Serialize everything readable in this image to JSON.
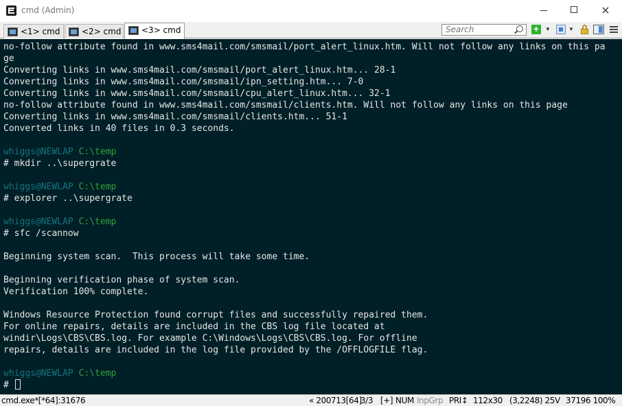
{
  "window": {
    "title": "cmd (Admin)",
    "app_icon": "conemu-icon",
    "controls": {
      "minimize": "minimize-icon",
      "maximize": "maximize-icon",
      "close": "×"
    }
  },
  "tabs": [
    {
      "label": "<1> cmd",
      "icon": "console-icon",
      "active": false
    },
    {
      "label": "<2> cmd",
      "icon": "console-icon",
      "active": false
    },
    {
      "label": "<3> cmd",
      "icon": "console-icon",
      "active": true
    }
  ],
  "toolbar": {
    "search_placeholder": "Search",
    "new_console": "+",
    "dropdown": "▼"
  },
  "console": {
    "lines": [
      "no-follow attribute found in www.sms4mail.com/smsmail/port_alert_linux.htm. Will not follow any links on this pa",
      "ge",
      "Converting links in www.sms4mail.com/smsmail/port_alert_linux.htm... 28-1",
      "Converting links in www.sms4mail.com/smsmail/ipn_setting.htm... 7-0",
      "Converting links in www.sms4mail.com/smsmail/cpu_alert_linux.htm... 32-1",
      "no-follow attribute found in www.sms4mail.com/smsmail/clients.htm. Will not follow any links on this page",
      "Converting links in www.sms4mail.com/smsmail/clients.htm... 51-1",
      "Converted links in 40 files in 0.3 seconds.",
      "",
      "",
      "# mkdir ..\\supergrate",
      "",
      "",
      "# explorer ..\\supergrate",
      "",
      "",
      "# sfc /scannow",
      "",
      "Beginning system scan.  This process will take some time.",
      "",
      "Beginning verification phase of system scan.",
      "Verification 100% complete.",
      "",
      "Windows Resource Protection found corrupt files and successfully repaired them.",
      "For online repairs, details are included in the CBS log file located at",
      "windir\\Logs\\CBS\\CBS.log. For example C:\\Windows\\Logs\\CBS\\CBS.log. For offline",
      "repairs, details are included in the log file provided by the /OFFLOGFILE flag.",
      "",
      "",
      "# "
    ],
    "prompt_user": "whiggs@NEWLAP",
    "prompt_path": "C:\\temp",
    "prompt_line_indexes": [
      9,
      12,
      15,
      28
    ],
    "colors": {
      "background": "#001f26",
      "text": "#e7e7e7",
      "user": "#16737f",
      "path": "#30a13b"
    }
  },
  "status": {
    "process": "cmd.exe*[*64]:31676",
    "info": "« 200713[64]",
    "pages": "3/3",
    "plus": "[+]",
    "num": "NUM",
    "group": "InpGrp",
    "pri": "PRI↕",
    "size": "112x30",
    "cursor": "(3,2248) 25V",
    "pid_zoom": "37196 100%"
  }
}
